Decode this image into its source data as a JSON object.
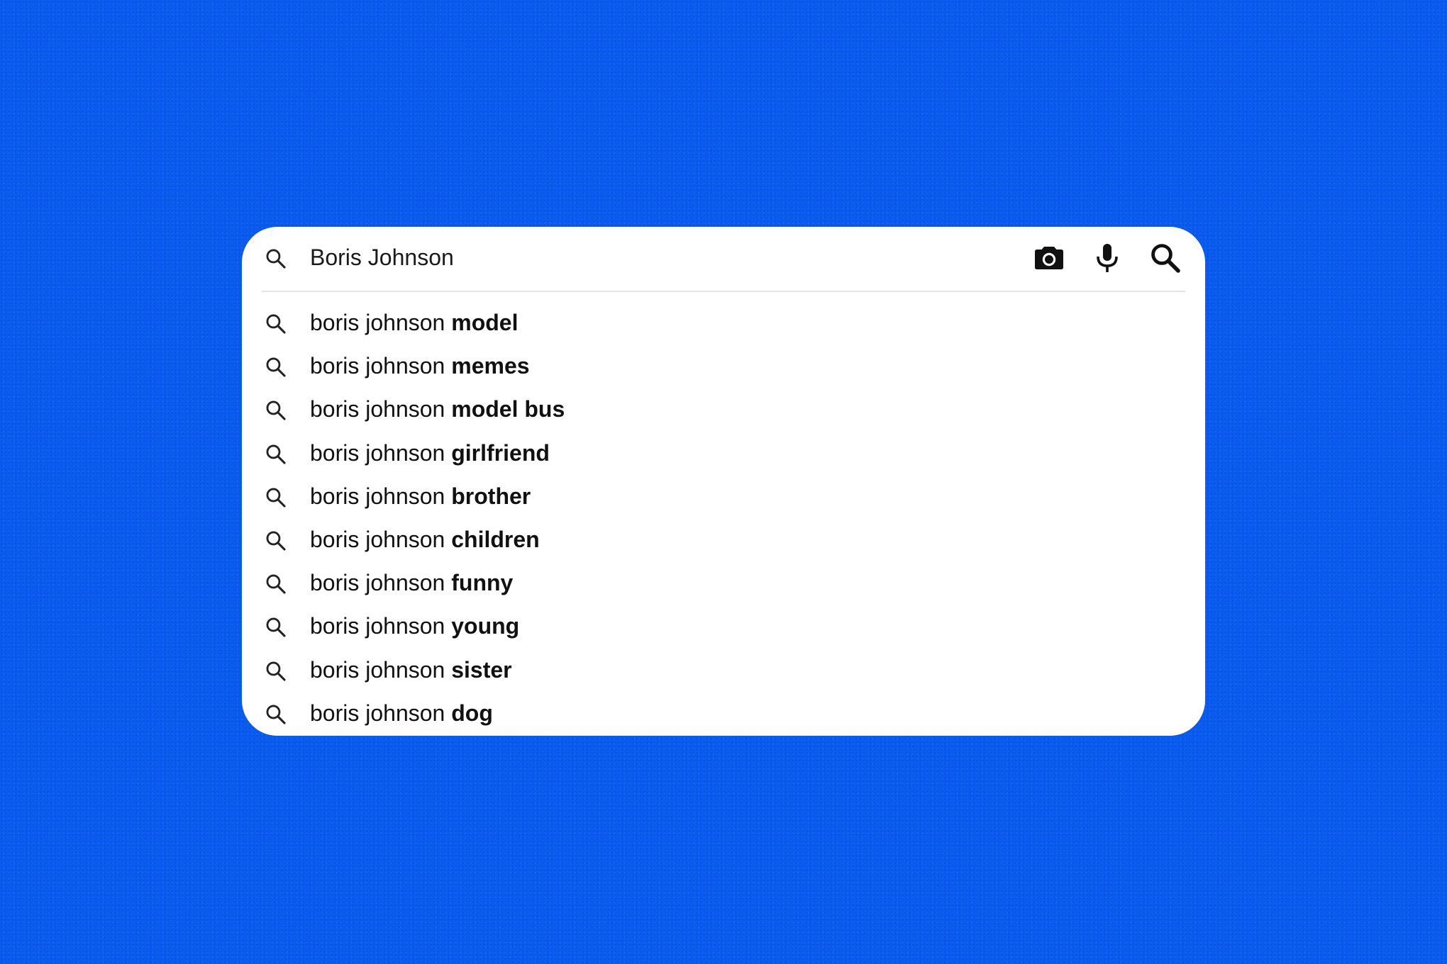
{
  "colors": {
    "background": "#0a5cf0",
    "box": "#ffffff",
    "text": "#111111",
    "divider": "#e4e4e4"
  },
  "search": {
    "value": "Boris Johnson",
    "leading_icon": "search-icon",
    "tools": [
      {
        "name": "camera-icon"
      },
      {
        "name": "microphone-icon"
      },
      {
        "name": "search-icon"
      }
    ]
  },
  "suggestions": [
    {
      "prefix": "boris johnson ",
      "completion": "model"
    },
    {
      "prefix": "boris johnson ",
      "completion": "memes"
    },
    {
      "prefix": "boris johnson ",
      "completion": "model bus"
    },
    {
      "prefix": "boris johnson ",
      "completion": "girlfriend"
    },
    {
      "prefix": "boris johnson ",
      "completion": "brother"
    },
    {
      "prefix": "boris johnson ",
      "completion": "children"
    },
    {
      "prefix": "boris johnson ",
      "completion": "funny"
    },
    {
      "prefix": "boris johnson ",
      "completion": "young"
    },
    {
      "prefix": "boris johnson ",
      "completion": "sister"
    },
    {
      "prefix": "boris johnson ",
      "completion": "dog"
    }
  ]
}
